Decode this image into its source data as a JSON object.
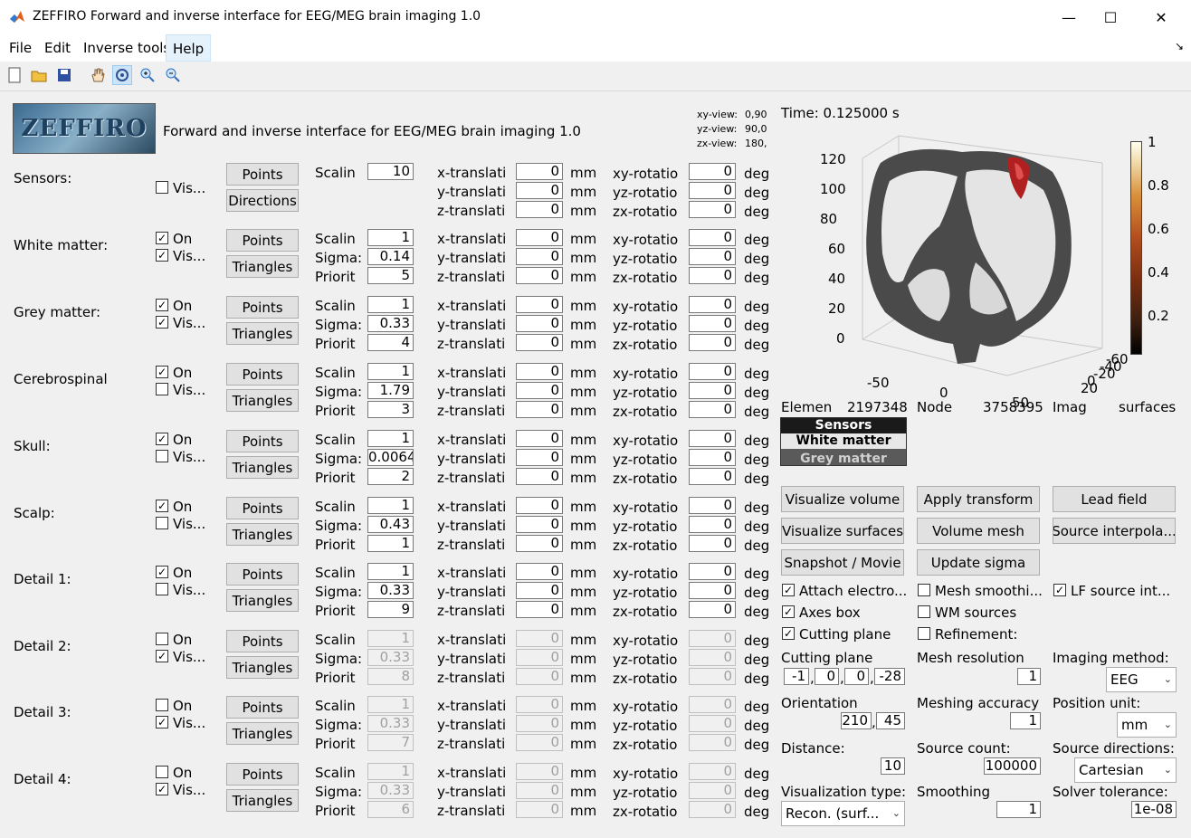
{
  "window": {
    "title": "ZEFFIRO Forward and inverse interface for EEG/MEG brain imaging 1.0",
    "min": "—",
    "max": "☐",
    "close": "✕"
  },
  "menu": {
    "file": "File",
    "edit": "Edit",
    "inverse": "Inverse tools",
    "help": "Help",
    "dock": "↘"
  },
  "header": {
    "logo": "ZEFFIRO",
    "subtitle": "Forward and inverse interface for EEG/MEG brain imaging 1.0",
    "xy_label": "xy-view:",
    "xy_val": "0,90",
    "yz_label": "yz-view:",
    "yz_val": "90,0",
    "zx_label": "zx-view:",
    "zx_val": "180,"
  },
  "labels": {
    "points": "Points",
    "directions": "Directions",
    "triangles": "Triangles",
    "on": "On",
    "vis": "Vis...",
    "scaling": "Scalin",
    "sigma": "Sigma:",
    "priority": "Priorit",
    "xt": "x-translati",
    "yt": "y-translati",
    "zt": "z-translati",
    "mm": "mm",
    "xr": "xy-rotatio",
    "yr": "yz-rotatio",
    "zr": "zx-rotatio",
    "deg": "deg"
  },
  "layers": [
    {
      "name": "Sensors:",
      "on": null,
      "vis": false,
      "scaling": "10",
      "sigma": null,
      "priority": null,
      "enabled": true
    },
    {
      "name": "White matter:",
      "on": true,
      "vis": true,
      "scaling": "1",
      "sigma": "0.14",
      "priority": "5",
      "enabled": true
    },
    {
      "name": "Grey matter:",
      "on": true,
      "vis": true,
      "scaling": "1",
      "sigma": "0.33",
      "priority": "4",
      "enabled": true
    },
    {
      "name": "Cerebrospinal",
      "on": true,
      "vis": false,
      "scaling": "1",
      "sigma": "1.79",
      "priority": "3",
      "enabled": true
    },
    {
      "name": "Skull:",
      "on": true,
      "vis": false,
      "scaling": "1",
      "sigma": "0.0064",
      "priority": "2",
      "enabled": true
    },
    {
      "name": "Scalp:",
      "on": true,
      "vis": false,
      "scaling": "1",
      "sigma": "0.43",
      "priority": "1",
      "enabled": true
    },
    {
      "name": "Detail 1:",
      "on": true,
      "vis": false,
      "scaling": "1",
      "sigma": "0.33",
      "priority": "9",
      "enabled": true
    },
    {
      "name": "Detail 2:",
      "on": false,
      "vis": true,
      "scaling": "1",
      "sigma": "0.33",
      "priority": "8",
      "enabled": false
    },
    {
      "name": "Detail 3:",
      "on": false,
      "vis": true,
      "scaling": "1",
      "sigma": "0.33",
      "priority": "7",
      "enabled": false
    },
    {
      "name": "Detail 4:",
      "on": false,
      "vis": true,
      "scaling": "1",
      "sigma": "0.33",
      "priority": "6",
      "enabled": false
    }
  ],
  "zero": "0",
  "plot": {
    "time": "Time: 0.125000 s",
    "yticks": [
      "120",
      "100",
      "80",
      "60",
      "40",
      "20",
      "0"
    ],
    "xticks": [
      "-50",
      "0",
      "50"
    ],
    "zticks": [
      "-60",
      "-40",
      "-20",
      "0",
      "20"
    ],
    "cticks": [
      "1",
      "0.8",
      "0.6",
      "0.4",
      "0.2"
    ]
  },
  "stats": {
    "elements": "Elemen",
    "elements_val": "2197348",
    "nodes": "Node",
    "nodes_val": "3758395",
    "imag": "Imag",
    "surfaces": "surfaces"
  },
  "list": [
    "Sensors",
    "White matter",
    "Grey matter"
  ],
  "buttons": {
    "viz_volume": "Visualize volume",
    "apply_transform": "Apply transform",
    "lead_field": "Lead field",
    "viz_surfaces": "Visualize surfaces",
    "volume_mesh": "Volume mesh",
    "source_interp": "Source interpola...",
    "snapshot": "Snapshot / Movie",
    "update_sigma": "Update sigma"
  },
  "checks": {
    "attach": "Attach electro...",
    "mesh_smooth": "Mesh smoothi...",
    "lf_source": "LF source int...",
    "axes_box": "Axes box",
    "wm_sources": "WM sources",
    "cutting": "Cutting plane",
    "refinement": "Refinement:"
  },
  "settings": {
    "cutting_plane": "Cutting plane",
    "cut_vals": [
      "-1",
      "0",
      "0",
      "-28"
    ],
    "mesh_res": "Mesh resolution",
    "mesh_res_val": "1",
    "imaging": "Imaging method:",
    "imaging_val": "EEG",
    "orientation": "Orientation",
    "orient_vals": [
      "210",
      "45"
    ],
    "meshing_acc": "Meshing accuracy",
    "meshing_acc_val": "1",
    "pos_unit": "Position unit:",
    "pos_unit_val": "mm",
    "distance": "Distance:",
    "distance_val": "10",
    "source_count": "Source count:",
    "source_count_val": "100000",
    "source_dir": "Source directions:",
    "source_dir_val": "Cartesian",
    "viz_type": "Visualization type:",
    "viz_type_val": "Recon. (surf...",
    "smoothing": "Smoothing",
    "smoothing_val": "1",
    "solver_tol": "Solver tolerance:",
    "solver_tol_val": "1e-08"
  }
}
